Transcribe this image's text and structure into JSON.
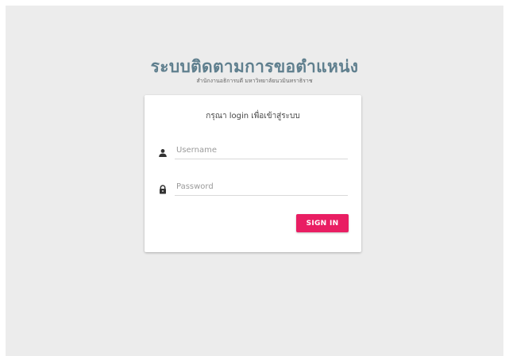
{
  "header": {
    "title": "ระบบติดตามการขอตำแหน่ง",
    "subtitle": "สำนักงานอธิการบดี มหาวิทยาลัยนวมินทราธิราช"
  },
  "login": {
    "heading": "กรุณา login เพื่อเข้าสู่ระบบ",
    "username_placeholder": "Username",
    "username_value": "",
    "password_placeholder": "Password",
    "password_value": "",
    "signin_label": "SIGN IN"
  },
  "icons": {
    "user": "person-icon",
    "password": "lock-icon"
  },
  "colors": {
    "background": "#ececec",
    "title": "#5f7f8e",
    "accent": "#e91e63",
    "card": "#ffffff"
  }
}
